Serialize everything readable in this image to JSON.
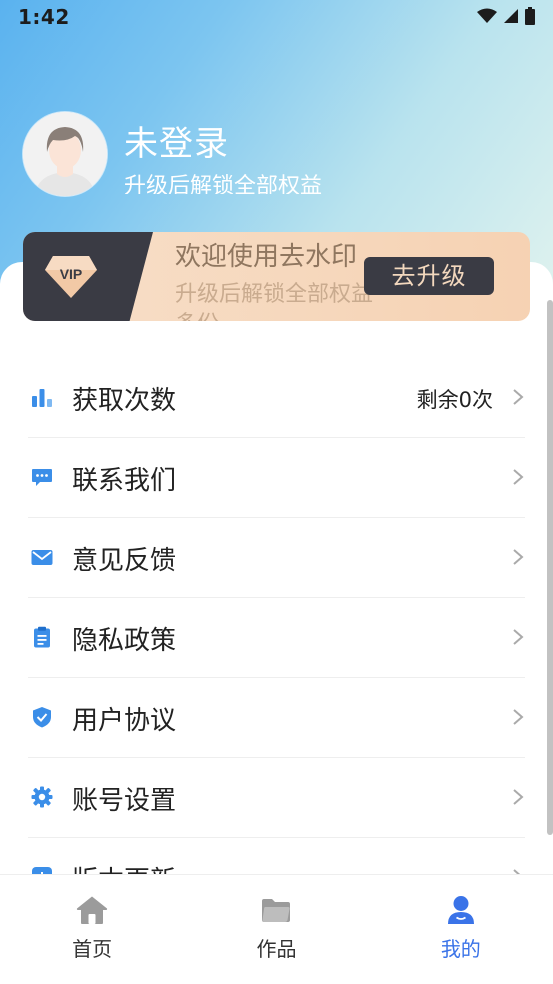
{
  "status_bar": {
    "time": "1:42"
  },
  "profile": {
    "name": "未登录",
    "subtitle": "升级后解锁全部权益"
  },
  "vip_card": {
    "badge_text": "VIP",
    "title": "欢迎使用去水印",
    "subtitle": "升级后解锁全部权益多份",
    "button_label": "去升级"
  },
  "menu": {
    "items": [
      {
        "label": "获取次数",
        "value": "剩余0次",
        "icon": "bar-chart-icon"
      },
      {
        "label": "联系我们",
        "value": "",
        "icon": "chat-bubble-icon"
      },
      {
        "label": "意见反馈",
        "value": "",
        "icon": "mail-icon"
      },
      {
        "label": "隐私政策",
        "value": "",
        "icon": "clipboard-icon"
      },
      {
        "label": "用户协议",
        "value": "",
        "icon": "shield-check-icon"
      },
      {
        "label": "账号设置",
        "value": "",
        "icon": "gear-icon"
      },
      {
        "label": "版本更新",
        "value": "",
        "icon": "update-icon"
      }
    ]
  },
  "bottom_nav": {
    "items": [
      {
        "label": "首页",
        "icon": "home-icon"
      },
      {
        "label": "作品",
        "icon": "folder-icon"
      },
      {
        "label": "我的",
        "icon": "user-icon",
        "active": true
      }
    ]
  },
  "colors": {
    "accent": "#3a73e8",
    "icon_blue": "#3b8ee8",
    "vip_dark": "#3a3b44",
    "vip_gold": "#f6d2b3"
  }
}
